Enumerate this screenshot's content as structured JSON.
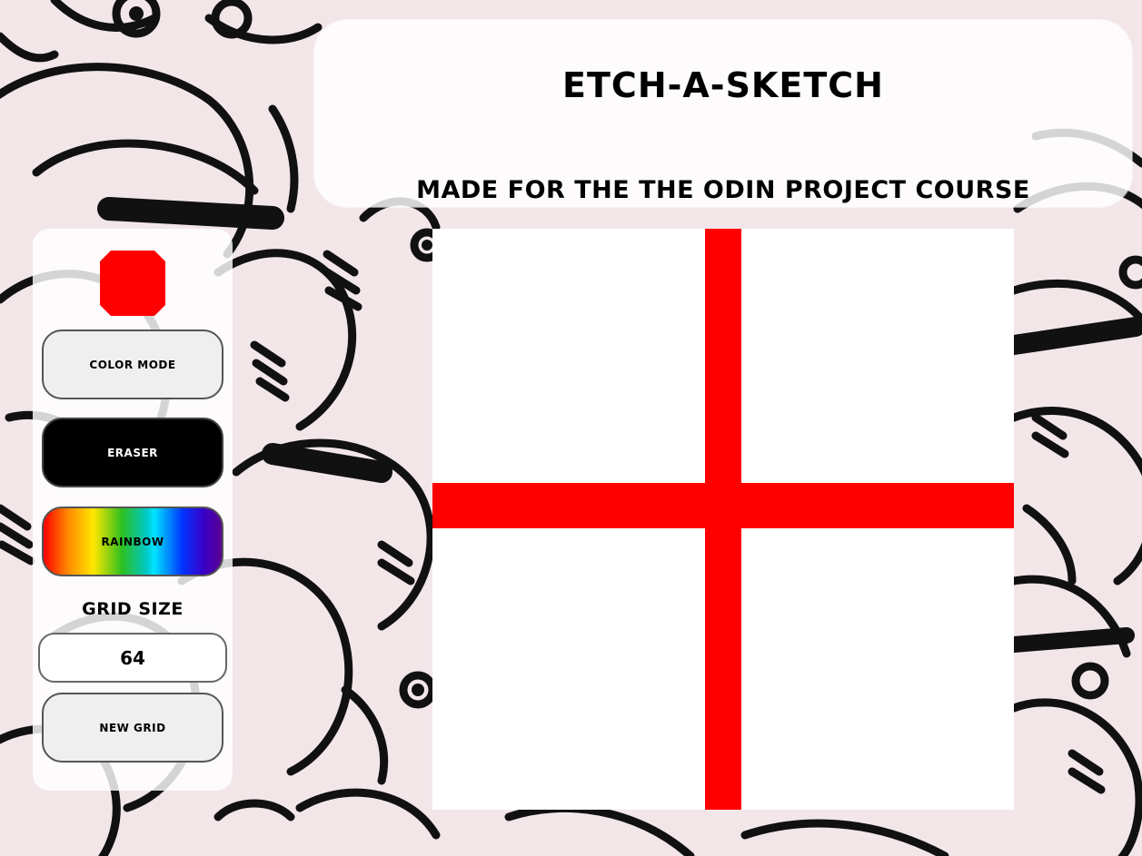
{
  "header": {
    "title": "Etch-A-Sketch",
    "subtitle": "Made for the The Odin Project course"
  },
  "sidebar": {
    "current_color": "#ff0000",
    "buttons": {
      "color_mode": "Color Mode",
      "eraser": "Eraser",
      "rainbow": "Rainbow",
      "new_grid": "New Grid"
    },
    "grid_size_label": "Grid Size",
    "grid_size_value": "64"
  },
  "sketch": {
    "background": "#ffffff",
    "stroke_color": "#ff0000"
  },
  "colors": {
    "accent": "#ff0000",
    "eraser_button": "#000000",
    "panel": "#ffffff"
  }
}
